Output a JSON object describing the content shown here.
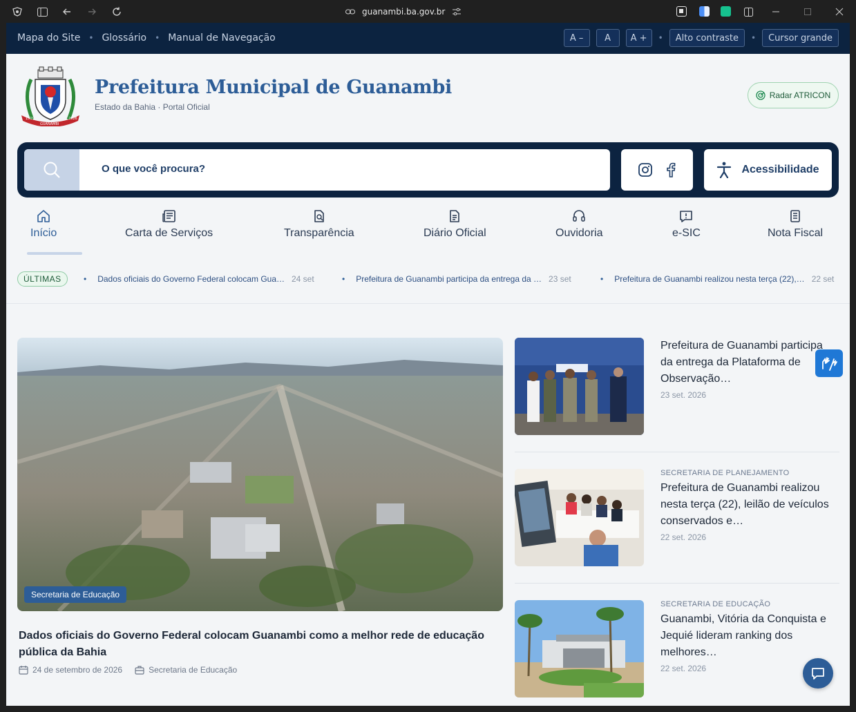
{
  "browser": {
    "url": "guanambi.ba.gov.br"
  },
  "topbar": {
    "links": [
      "Mapa do Site",
      "Glossário",
      "Manual de Navegação"
    ],
    "font_decrease": "A –",
    "font_reset": "A",
    "font_increase": "A +",
    "high_contrast": "Alto contraste",
    "big_cursor": "Cursor grande"
  },
  "header": {
    "title": "Prefeitura Municipal de Guanambi",
    "subtitle": "Estado da Bahia · Portal Oficial",
    "radar_label": "Radar ATRICON",
    "logo_years": [
      "1919",
      "2026"
    ],
    "logo_name": "GUANAMBI"
  },
  "search": {
    "placeholder": "O que você procura?",
    "accessibility_label": "Acessibilidade"
  },
  "nav": {
    "items": [
      {
        "label": "Início",
        "icon": "home-icon"
      },
      {
        "label": "Carta de Serviços",
        "icon": "newspaper-icon"
      },
      {
        "label": "Transparência",
        "icon": "file-search-icon"
      },
      {
        "label": "Diário Oficial",
        "icon": "document-icon"
      },
      {
        "label": "Ouvidoria",
        "icon": "headset-icon"
      },
      {
        "label": "e-SIC",
        "icon": "message-alert-icon"
      },
      {
        "label": "Nota Fiscal",
        "icon": "receipt-icon"
      }
    ]
  },
  "ticker": {
    "label": "ÚLTIMAS",
    "items": [
      {
        "text": "Dados oficiais do Governo Federal colocam Gua…",
        "date": "24 set"
      },
      {
        "text": "Prefeitura de Guanambi participa da entrega da …",
        "date": "23 set"
      },
      {
        "text": "Prefeitura de Guanambi realizou nesta terça (22),…",
        "date": "22 set"
      }
    ]
  },
  "hero": {
    "badge": "Secretaria de Educação",
    "title": "Dados oficiais do Governo Federal colocam Guanambi como a melhor rede de educação pública da Bahia",
    "date": "24 de setembro de 2026",
    "category": "Secretaria de Educação"
  },
  "news": [
    {
      "category": "",
      "title": "Prefeitura de Guanambi participa da entrega da Plataforma de Observação…",
      "date": "23 set. 2026"
    },
    {
      "category": "SECRETARIA DE PLANEJAMENTO",
      "title": "Prefeitura de Guanambi realizou nesta terça (22), leilão de veículos conservados e…",
      "date": "22 set. 2026"
    },
    {
      "category": "SECRETARIA DE EDUCAÇÃO",
      "title": "Guanambi, Vitória da Conquista e Jequié lideram ranking dos melhores…",
      "date": "22 set. 2026"
    }
  ],
  "colors": {
    "navy": "#0c2340",
    "primary": "#2d5d97",
    "green_badge": "#1d5a38",
    "libras_blue": "#1f78d6"
  }
}
